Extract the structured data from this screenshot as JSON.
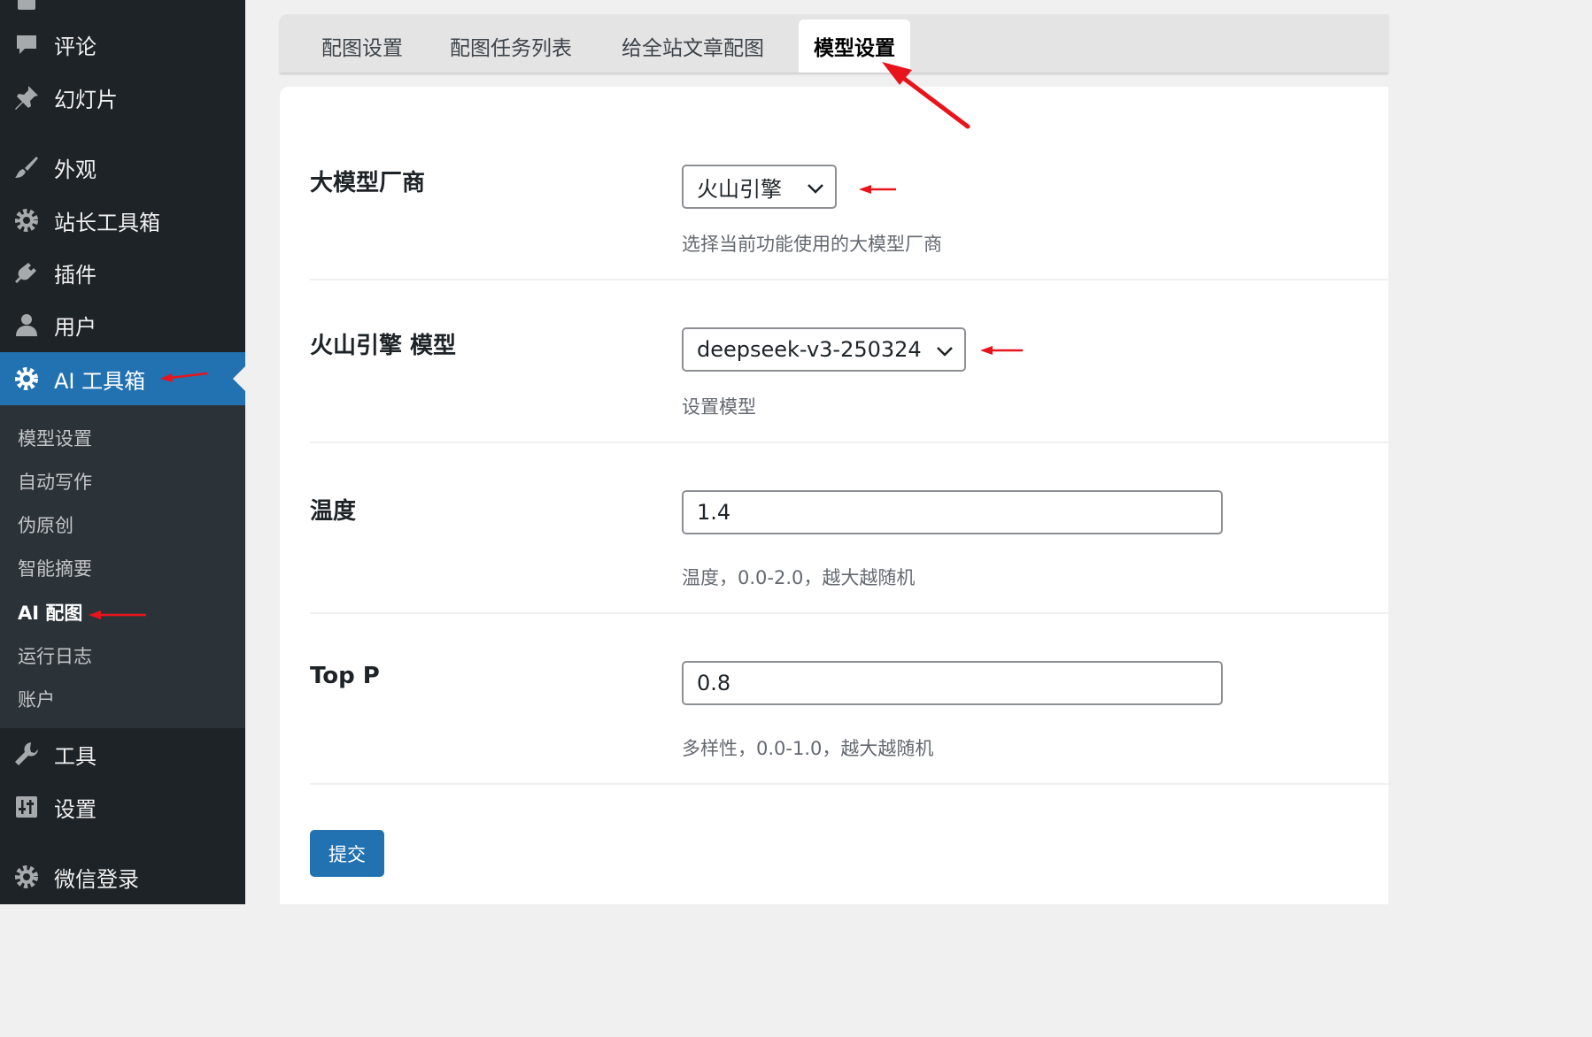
{
  "sidebar": {
    "items": [
      {
        "label": "评论",
        "icon": "comment-icon"
      },
      {
        "label": "幻灯片",
        "icon": "pin-icon"
      },
      {
        "label": "外观",
        "icon": "brush-icon"
      },
      {
        "label": "站长工具箱",
        "icon": "gear-icon"
      },
      {
        "label": "插件",
        "icon": "plugin-icon"
      },
      {
        "label": "用户",
        "icon": "user-icon"
      },
      {
        "label": "AI 工具箱",
        "icon": "gear-icon",
        "active": true
      },
      {
        "label": "工具",
        "icon": "wrench-icon"
      },
      {
        "label": "设置",
        "icon": "settings-sliders-icon"
      },
      {
        "label": "微信登录",
        "icon": "gear-icon"
      }
    ],
    "submenu": [
      {
        "label": "模型设置"
      },
      {
        "label": "自动写作"
      },
      {
        "label": "伪原创"
      },
      {
        "label": "智能摘要"
      },
      {
        "label": "AI 配图",
        "current": true
      },
      {
        "label": "运行日志"
      },
      {
        "label": "账户"
      }
    ]
  },
  "tabs": [
    {
      "label": "配图设置"
    },
    {
      "label": "配图任务列表"
    },
    {
      "label": "给全站文章配图"
    },
    {
      "label": "模型设置",
      "active": true
    }
  ],
  "form": {
    "vendor": {
      "label": "大模型厂商",
      "value": "火山引擎",
      "description": "选择当前功能使用的大模型厂商"
    },
    "model": {
      "label": "火山引擎 模型",
      "value": "deepseek-v3-250324",
      "description": "设置模型"
    },
    "temperature": {
      "label": "温度",
      "value": "1.4",
      "description": "温度，0.0-2.0，越大越随机"
    },
    "top_p": {
      "label": "Top P",
      "value": "0.8",
      "description": "多样性，0.0-1.0，越大越随机"
    },
    "submit_label": "提交"
  },
  "colors": {
    "sidebar_bg": "#1d2327",
    "submenu_bg": "#2c3338",
    "accent": "#2271b1",
    "annotation_red": "#e8141c"
  }
}
